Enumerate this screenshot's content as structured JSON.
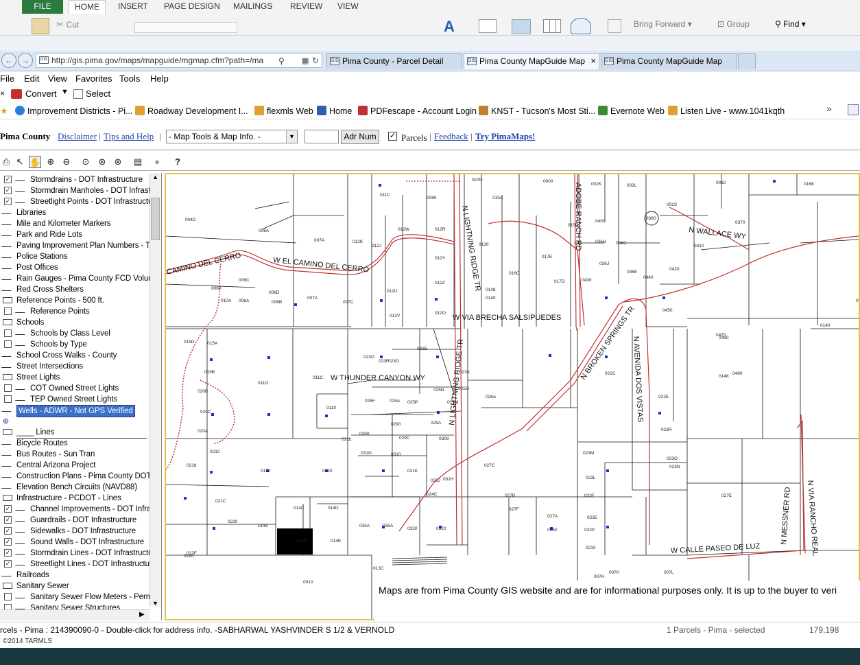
{
  "ribbon": {
    "file_tab": "FILE",
    "tabs": [
      "HOME",
      "INSERT",
      "PAGE DESIGN",
      "MAILINGS",
      "REVIEW",
      "VIEW"
    ],
    "active_tab": "HOME",
    "cut_label": "Cut",
    "bring_forward_label": "Bring Forward",
    "group_label": "Group",
    "find_label": "Find"
  },
  "browser": {
    "address": "http://gis.pima.gov/maps/mapguide/mgmap.cfm?path=/ma",
    "tabs": [
      {
        "label": "Pima County - Parcel Detail",
        "selected": false
      },
      {
        "label": "Pima County MapGuide Map",
        "selected": true
      },
      {
        "label": "Pima County MapGuide Map",
        "selected": false
      }
    ],
    "close_glyph": "×",
    "menu": [
      "File",
      "Edit",
      "View",
      "Favorites",
      "Tools",
      "Help"
    ],
    "convert_label": "Convert",
    "select_label": "Select",
    "favorites": [
      {
        "label": "Improvement Districts - Pi...",
        "color": "#2a7fd4"
      },
      {
        "label": "Roadway Development I...",
        "color": "#e0a030"
      },
      {
        "label": "flexmls Web",
        "color": "#e0a030"
      },
      {
        "label": "Home",
        "color": "#2f5fa8"
      },
      {
        "label": "PDFescape - Account Login",
        "color": "#c03030"
      },
      {
        "label": "KNST - Tucson's Most Sti...",
        "color": "#c08030"
      },
      {
        "label": "Evernote Web",
        "color": "#3a8a3a"
      },
      {
        "label": "Listen Live - www.1041kqth",
        "color": "#e0a030"
      }
    ],
    "more_glyph": "»"
  },
  "site": {
    "title": "Pima County",
    "links": [
      "Disclaimer",
      "Tips and Help"
    ],
    "tools_select": "- Map Tools & Map Info. -",
    "adr_button": "Adr Num",
    "parcels_label": "Parcels",
    "parcels_checked": true,
    "feedback": "Feedback",
    "try_pimamaps": "Try PimaMaps!"
  },
  "layers": [
    {
      "label": "Stormdrains - DOT Infrastructure",
      "indent": 1,
      "checkbox": true,
      "checked": true,
      "icon": "line"
    },
    {
      "label": "Stormdrain Manholes - DOT Infrastru",
      "indent": 1,
      "checkbox": true,
      "checked": true,
      "icon": "line"
    },
    {
      "label": "Streetlight Points - DOT Infrastructure",
      "indent": 1,
      "checkbox": true,
      "checked": true,
      "icon": "line"
    },
    {
      "label": "Libraries",
      "indent": 0,
      "checkbox": false,
      "icon": "line"
    },
    {
      "label": "Mile and Kilometer Markers",
      "indent": 0,
      "checkbox": false,
      "icon": "line"
    },
    {
      "label": "Park and Ride Lots",
      "indent": 0,
      "checkbox": false,
      "icon": "line"
    },
    {
      "label": "Paving Improvement Plan Numbers - Tuc",
      "indent": 0,
      "checkbox": false,
      "icon": "line"
    },
    {
      "label": "Police Stations",
      "indent": 0,
      "checkbox": false,
      "icon": "line"
    },
    {
      "label": "Post Offices",
      "indent": 0,
      "checkbox": false,
      "icon": "line"
    },
    {
      "label": "Rain Gauges - Pima County FCD Volunte",
      "indent": 0,
      "checkbox": false,
      "icon": "line"
    },
    {
      "label": "Red Cross Shelters",
      "indent": 0,
      "checkbox": false,
      "icon": "line"
    },
    {
      "label": "Reference Points - 500 ft.",
      "indent": 0,
      "checkbox": false,
      "icon": "group"
    },
    {
      "label": "Reference Points",
      "indent": 1,
      "checkbox": true,
      "checked": false,
      "icon": "line"
    },
    {
      "label": "Schools",
      "indent": 0,
      "checkbox": false,
      "icon": "group"
    },
    {
      "label": "Schools by Class Level",
      "indent": 1,
      "checkbox": true,
      "checked": false,
      "icon": "line"
    },
    {
      "label": "Schools by Type",
      "indent": 1,
      "checkbox": true,
      "checked": false,
      "icon": "line"
    },
    {
      "label": "School Cross Walks - County",
      "indent": 0,
      "checkbox": false,
      "icon": "line"
    },
    {
      "label": "Street Intersections",
      "indent": 0,
      "checkbox": false,
      "icon": "line"
    },
    {
      "label": "Street Lights",
      "indent": 0,
      "checkbox": false,
      "icon": "group"
    },
    {
      "label": "COT Owned Street Lights",
      "indent": 1,
      "checkbox": true,
      "checked": false,
      "icon": "line"
    },
    {
      "label": "TEP Owned Street Lights",
      "indent": 1,
      "checkbox": true,
      "checked": false,
      "icon": "line"
    },
    {
      "label": "Wells - ADWR - Not GPS Verified",
      "indent": 0,
      "checkbox": false,
      "icon": "line",
      "highlight": true
    },
    {
      "label": "",
      "indent": 0,
      "checkbox": false,
      "icon": "dot"
    },
    {
      "label": "____ Lines",
      "indent": 0,
      "checkbox": false,
      "icon": "group",
      "separator": true
    },
    {
      "label": "Bicycle Routes",
      "indent": 0,
      "checkbox": false,
      "icon": "line"
    },
    {
      "label": "Bus Routes - Sun Tran",
      "indent": 0,
      "checkbox": false,
      "icon": "line"
    },
    {
      "label": "Central Arizona Project",
      "indent": 0,
      "checkbox": false,
      "icon": "line"
    },
    {
      "label": "Construction Plans - Pima County DOT",
      "indent": 0,
      "checkbox": false,
      "icon": "line"
    },
    {
      "label": "Elevation Bench Circuits (NAVD88)",
      "indent": 0,
      "checkbox": false,
      "icon": "line"
    },
    {
      "label": "Infrastructure - PCDOT - Lines",
      "indent": 0,
      "checkbox": false,
      "icon": "group"
    },
    {
      "label": "Channel Improvements - DOT Infrast",
      "indent": 1,
      "checkbox": true,
      "checked": true,
      "icon": "line"
    },
    {
      "label": "Guardrails - DOT Infrastructure",
      "indent": 1,
      "checkbox": true,
      "checked": true,
      "icon": "line"
    },
    {
      "label": "Sidewalks - DOT Infrastructure",
      "indent": 1,
      "checkbox": true,
      "checked": true,
      "icon": "line"
    },
    {
      "label": "Sound Walls - DOT Infrastructure",
      "indent": 1,
      "checkbox": true,
      "checked": true,
      "icon": "line"
    },
    {
      "label": "Stormdrain Lines - DOT Infrastructure",
      "indent": 1,
      "checkbox": true,
      "checked": true,
      "icon": "line"
    },
    {
      "label": "Streetlight Lines - DOT Infrastructure",
      "indent": 1,
      "checkbox": true,
      "checked": true,
      "icon": "line"
    },
    {
      "label": "Railroads",
      "indent": 0,
      "checkbox": false,
      "icon": "line"
    },
    {
      "label": "Sanitary Sewer",
      "indent": 0,
      "checkbox": false,
      "icon": "group"
    },
    {
      "label": "Sanitary Sewer Flow Meters - Perma",
      "indent": 1,
      "checkbox": true,
      "checked": false,
      "icon": "line"
    },
    {
      "label": "Sanitary Sewer Structures",
      "indent": 1,
      "checkbox": true,
      "checked": false,
      "icon": "line"
    }
  ],
  "map": {
    "streets": [
      {
        "label": "CAMINO DEL CERRO",
        "rot": -13
      },
      {
        "label": "W EL CAMINO DEL CERRO",
        "rot": 6
      },
      {
        "label": "N LIGHTNING RIDGE TR",
        "rot": 81
      },
      {
        "label": "W VIA BRECHA SALSIPUEDES",
        "rot": 0
      },
      {
        "label": "W THUNDER CANYON WY",
        "rot": 0
      },
      {
        "label": "N LIGHTNING RIDGE TR",
        "rot": -84
      },
      {
        "label": "ADOBE RANCH RD",
        "rot": 90
      },
      {
        "label": "N BROKEN SPRINGS TR",
        "rot": -55
      },
      {
        "label": "N AVENIDA DOS VISTAS",
        "rot": 87
      },
      {
        "label": "N WALLACE WY",
        "rot": 7
      },
      {
        "label": "W CALLE PASEO DE LUZ",
        "rot": -3
      },
      {
        "label": "N MESSNER RD",
        "rot": -86
      },
      {
        "label": "N VIA RANCHO REAL",
        "rot": 86
      }
    ],
    "parcels": [
      {
        "label": "004D"
      },
      {
        "label": "006A"
      },
      {
        "label": "007A"
      },
      {
        "label": "012K"
      },
      {
        "label": "012J"
      },
      {
        "label": "012W"
      },
      {
        "label": "012R"
      },
      {
        "label": "012Y"
      },
      {
        "label": "011C"
      },
      {
        "label": "0080"
      },
      {
        "label": "007D"
      },
      {
        "label": "015A"
      },
      {
        "label": "0000"
      },
      {
        "label": "002K"
      },
      {
        "label": "002L"
      },
      {
        "label": "0010"
      },
      {
        "label": "0168"
      },
      {
        "label": "002S"
      },
      {
        "label": "0380"
      },
      {
        "label": "0370"
      },
      {
        "label": "0410"
      },
      {
        "label": "0420"
      },
      {
        "label": "0400"
      },
      {
        "label": "0130"
      },
      {
        "label": "016C"
      },
      {
        "label": "015D"
      },
      {
        "label": "017E"
      },
      {
        "label": "017D"
      },
      {
        "label": "0430"
      },
      {
        "label": "036H"
      },
      {
        "label": "036J"
      },
      {
        "label": "036C"
      },
      {
        "label": "036E"
      },
      {
        "label": "0440"
      },
      {
        "label": "0450"
      },
      {
        "label": "0148"
      },
      {
        "label": "0140"
      },
      {
        "label": "012U"
      },
      {
        "label": "012Z"
      },
      {
        "label": "012V"
      },
      {
        "label": "012O"
      },
      {
        "label": "007C"
      },
      {
        "label": "007A"
      },
      {
        "label": "006C"
      },
      {
        "label": "006D"
      },
      {
        "label": "006A"
      },
      {
        "label": "010A"
      },
      {
        "label": "006B"
      },
      {
        "label": "0060"
      },
      {
        "label": "015D"
      },
      {
        "label": "015A"
      },
      {
        "label": "015B"
      },
      {
        "label": "020B"
      },
      {
        "label": "020C"
      },
      {
        "label": "020A"
      },
      {
        "label": "011G"
      },
      {
        "label": "011C"
      },
      {
        "label": "0110"
      },
      {
        "label": "023O"
      },
      {
        "label": "023F"
      },
      {
        "label": "023E"
      },
      {
        "label": "023O"
      },
      {
        "label": "023K"
      },
      {
        "label": "025O"
      },
      {
        "label": "025F"
      },
      {
        "label": "025A"
      },
      {
        "label": "025P"
      },
      {
        "label": "025N"
      },
      {
        "label": "025M"
      },
      {
        "label": "026A"
      },
      {
        "label": "029A"
      },
      {
        "label": "0290"
      },
      {
        "label": "029C"
      },
      {
        "label": "0300"
      },
      {
        "label": "0308"
      },
      {
        "label": "031L"
      },
      {
        "label": "031G"
      },
      {
        "label": "0310"
      },
      {
        "label": "031K"
      },
      {
        "label": "031J"
      },
      {
        "label": "031H"
      },
      {
        "label": "0220"
      },
      {
        "label": "022F"
      },
      {
        "label": "022C"
      },
      {
        "label": "022E"
      },
      {
        "label": "023R"
      },
      {
        "label": "023O"
      },
      {
        "label": "023N"
      },
      {
        "label": "023M"
      },
      {
        "label": "023L"
      },
      {
        "label": "023F"
      },
      {
        "label": "023E"
      },
      {
        "label": "023P"
      },
      {
        "label": "0210"
      },
      {
        "label": "027E"
      },
      {
        "label": "027C"
      },
      {
        "label": "027B"
      },
      {
        "label": "027F"
      },
      {
        "label": "027A"
      },
      {
        "label": "0460"
      },
      {
        "label": "0470"
      },
      {
        "label": "0480"
      },
      {
        "label": "0490"
      },
      {
        "label": "0148"
      },
      {
        "label": "0140"
      },
      {
        "label": "0220"
      },
      {
        "label": "0218"
      },
      {
        "label": "0210"
      },
      {
        "label": "021C"
      },
      {
        "label": "0220"
      },
      {
        "label": "0148"
      },
      {
        "label": "014C"
      },
      {
        "label": "014D"
      },
      {
        "label": "014A"
      },
      {
        "label": "014E"
      },
      {
        "label": "013C"
      },
      {
        "label": "0010"
      },
      {
        "label": "035A"
      },
      {
        "label": "035A"
      },
      {
        "label": "0330"
      },
      {
        "label": "0320"
      },
      {
        "label": "007L"
      },
      {
        "label": "007K"
      },
      {
        "label": "007H"
      },
      {
        "label": "0120"
      },
      {
        "label": "0130"
      },
      {
        "label": "024C"
      }
    ],
    "well_color": "#1a2fd0",
    "road_color": "#c03030",
    "selected_parcel_color": "#000000"
  },
  "notice": "Maps are from Pima County GIS website and are for informational purposes only.  It is up to the buyer to veri",
  "status": "rcels - Pima : 214390090-0 - Double-click for address info. -SABHARWAL YASHVINDER S 1/2 & VERNOLD",
  "status_right": "1  Parcels - Pima - selected",
  "status_coord": "179,198",
  "footer": "©2014 TARMLS"
}
